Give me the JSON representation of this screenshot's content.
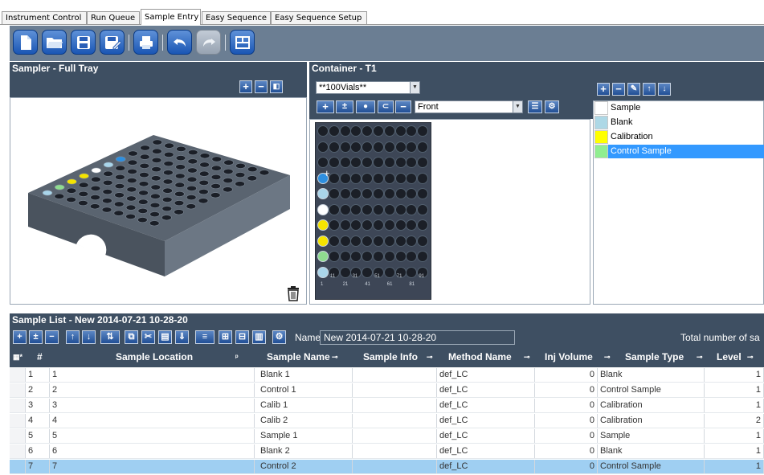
{
  "tabs": [
    "Instrument Control",
    "Run Queue",
    "Sample Entry",
    "Easy Sequence",
    "Easy Sequence Setup"
  ],
  "active_tab": "Sample Entry",
  "toolbar_icons": [
    "new-document-icon",
    "open-folder-icon",
    "save-icon",
    "save-as-icon",
    "print-icon",
    "undo-icon",
    "redo-icon",
    "layout-icon"
  ],
  "sampler": {
    "title": "Sampler - Full Tray"
  },
  "container": {
    "title": "Container - T1",
    "vial_type": "**100Vials**",
    "view": "Front",
    "col_labels": [
      "11",
      "31",
      "51",
      "71",
      "91"
    ],
    "row_labels": [
      "1",
      "21",
      "41",
      "61",
      "81"
    ],
    "vial_colors": [
      "#2e8fe0",
      "#a9d5ea",
      "#ffffff",
      "#f5e400",
      "#f5e400",
      "#8fdc8f",
      "#a9d5ea"
    ]
  },
  "sample_types": [
    {
      "label": "Sample",
      "color": "#ffffff",
      "selected": false
    },
    {
      "label": "Blank",
      "color": "#add8e6",
      "selected": false
    },
    {
      "label": "Calibration",
      "color": "#ffff00",
      "selected": false
    },
    {
      "label": "Control Sample",
      "color": "#90ee90",
      "selected": true
    }
  ],
  "sample_list": {
    "title": "Sample List - New 2014-07-21 10-28-20",
    "name_label": "Name",
    "name_value": "New 2014-07-21 10-28-20",
    "total_label": "Total number of sa",
    "columns": [
      "#",
      "Sample Location",
      "Sample Name",
      "Sample Info",
      "Method Name",
      "Inj Volume",
      "Sample Type",
      "Level"
    ],
    "rows": [
      {
        "num": "1",
        "location": "1",
        "name": "Blank 1",
        "info": "",
        "method": "def_LC",
        "volume": "0",
        "type": "Blank",
        "level": "1"
      },
      {
        "num": "2",
        "location": "2",
        "name": "Control 1",
        "info": "",
        "method": "def_LC",
        "volume": "0",
        "type": "Control Sample",
        "level": "1"
      },
      {
        "num": "3",
        "location": "3",
        "name": "Calib 1",
        "info": "",
        "method": "def_LC",
        "volume": "0",
        "type": "Calibration",
        "level": "1"
      },
      {
        "num": "4",
        "location": "4",
        "name": "Calib 2",
        "info": "",
        "method": "def_LC",
        "volume": "0",
        "type": "Calibration",
        "level": "2"
      },
      {
        "num": "5",
        "location": "5",
        "name": "Sample 1",
        "info": "",
        "method": "def_LC",
        "volume": "0",
        "type": "Sample",
        "level": "1"
      },
      {
        "num": "6",
        "location": "6",
        "name": "Blank 2",
        "info": "",
        "method": "def_LC",
        "volume": "0",
        "type": "Blank",
        "level": "1"
      },
      {
        "num": "7",
        "location": "7",
        "name": "Control 2",
        "info": "",
        "method": "def_LC",
        "volume": "0",
        "type": "Control Sample",
        "level": "1"
      }
    ],
    "selected_row": 7
  }
}
